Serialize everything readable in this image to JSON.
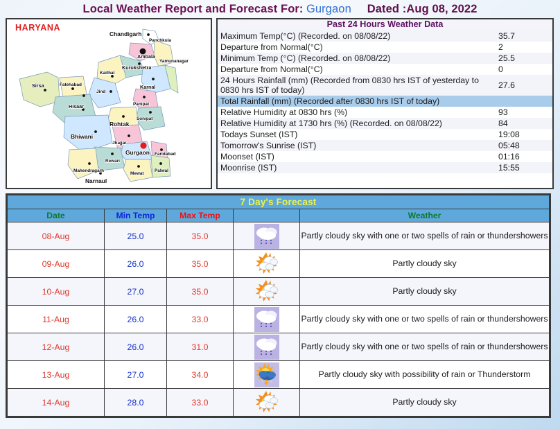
{
  "title": {
    "prefix": "Local Weather Report and Forecast For:",
    "city": "Gurgaon",
    "dated": "Dated :Aug 08, 2022"
  },
  "map": {
    "state_label": "HARYANA",
    "marker_city": "Gurgaon",
    "marker_color": "#e81b1b",
    "capital_label": "Chandigarh",
    "districts": [
      "Chandigarh",
      "Panchkula",
      "Ambala",
      "Yamunanagar",
      "Kurukshetra",
      "Kaithal",
      "Karnal",
      "Sirsa",
      "Fatehabad",
      "Jind",
      "Panipat",
      "Hisaar",
      "Sonipat",
      "Rohtak",
      "Bhiwani",
      "Jhajjar",
      "Gurgaon",
      "Faridabad",
      "Rewari",
      "Mewat",
      "Palwal",
      "Mahendragarh",
      "Narnaul"
    ]
  },
  "past24": {
    "header": "Past 24 Hours Weather Data",
    "rows": [
      {
        "label": "Maximum Temp(°C) (Recorded. on 08/08/22)",
        "value": "35.7",
        "style": "alt"
      },
      {
        "label": "Departure from Normal(°C)",
        "value": "2",
        "style": "plain"
      },
      {
        "label": "Minimum Temp (°C) (Recorded. on 08/08/22)",
        "value": "25.5",
        "style": "alt"
      },
      {
        "label": "Departure from Normal(°C)",
        "value": "0",
        "style": "plain"
      },
      {
        "label": "24 Hours Rainfall (mm) (Recorded from 0830 hrs IST of yesterday to 0830 hrs IST of today)",
        "value": "27.6",
        "style": "alt"
      },
      {
        "label": "Total Rainfall (mm) (Recorded after 0830 hrs IST of today)",
        "value": "",
        "style": "hl"
      },
      {
        "label": "Relative Humidity at 0830 hrs (%)",
        "value": "93",
        "style": "plain"
      },
      {
        "label": "Relative Humidity at 1730 hrs (%) (Recorded. on 08/08/22)",
        "value": "84",
        "style": "alt"
      },
      {
        "label": "Todays Sunset (IST)",
        "value": "19:08",
        "style": "plain"
      },
      {
        "label": "Tomorrow's Sunrise (IST)",
        "value": "05:48",
        "style": "alt"
      },
      {
        "label": "Moonset (IST)",
        "value": "01:16",
        "style": "plain"
      },
      {
        "label": "Moonrise (IST)",
        "value": "15:55",
        "style": "alt"
      }
    ]
  },
  "forecast": {
    "title": "7 Day's Forecast",
    "columns": {
      "date": "Date",
      "min": "Min Temp",
      "max": "Max Temp",
      "icon": "",
      "weather": "Weather"
    },
    "rows": [
      {
        "date": "08-Aug",
        "min": "25.0",
        "max": "35.0",
        "icon": "rain-cloud-icon",
        "weather": "Partly cloudy sky with one or two spells of rain or thundershowers"
      },
      {
        "date": "09-Aug",
        "min": "26.0",
        "max": "35.0",
        "icon": "sun-cloud-icon",
        "weather": "Partly cloudy sky"
      },
      {
        "date": "10-Aug",
        "min": "27.0",
        "max": "35.0",
        "icon": "sun-cloud-icon",
        "weather": "Partly cloudy sky"
      },
      {
        "date": "11-Aug",
        "min": "26.0",
        "max": "33.0",
        "icon": "rain-cloud-icon",
        "weather": "Partly cloudy sky with one or two spells of rain or thundershowers"
      },
      {
        "date": "12-Aug",
        "min": "26.0",
        "max": "31.0",
        "icon": "rain-cloud-icon",
        "weather": "Partly cloudy sky with one or two spells of rain or thundershowers"
      },
      {
        "date": "13-Aug",
        "min": "27.0",
        "max": "34.0",
        "icon": "sun-thunder-icon",
        "weather": "Partly cloudy sky with possibility of rain or Thunderstorm"
      },
      {
        "date": "14-Aug",
        "min": "28.0",
        "max": "33.0",
        "icon": "sun-cloud-icon",
        "weather": "Partly cloudy sky"
      }
    ]
  },
  "colors": {
    "title_main": "#6b0f52",
    "title_city": "#2f6fd0",
    "header_blue": "#5fa8dc",
    "header_yellow": "#f2f542",
    "date_red": "#e0392b",
    "min_blue": "#122fc8",
    "highlight_row": "#a9ccea"
  }
}
